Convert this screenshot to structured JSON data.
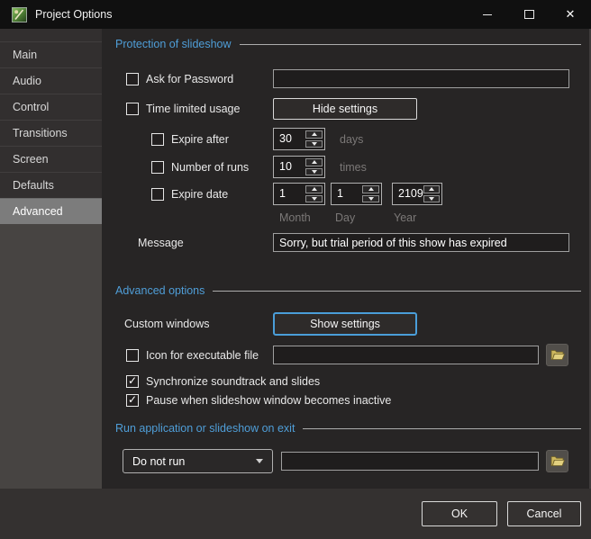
{
  "window": {
    "title": "Project Options"
  },
  "sidebar": {
    "items": [
      {
        "label": "Main",
        "selected": false
      },
      {
        "label": "Audio",
        "selected": false
      },
      {
        "label": "Control",
        "selected": false
      },
      {
        "label": "Transitions",
        "selected": false
      },
      {
        "label": "Screen",
        "selected": false
      },
      {
        "label": "Defaults",
        "selected": false
      },
      {
        "label": "Advanced",
        "selected": true
      }
    ]
  },
  "sections": {
    "protection": {
      "title": "Protection of slideshow",
      "ask_for_password": {
        "label": "Ask for Password",
        "checked": false,
        "value": ""
      },
      "time_limited": {
        "label": "Time limited usage",
        "checked": false,
        "button": "Hide settings"
      },
      "expire_after": {
        "label": "Expire after",
        "checked": false,
        "value": "30",
        "unit": "days"
      },
      "number_of_runs": {
        "label": "Number of runs",
        "checked": false,
        "value": "10",
        "unit": "times"
      },
      "expire_date": {
        "label": "Expire date",
        "checked": false,
        "month": "1",
        "day": "1",
        "year": "2109",
        "month_label": "Month",
        "day_label": "Day",
        "year_label": "Year"
      },
      "message": {
        "label": "Message",
        "value": "Sorry, but trial period of this show has expired"
      }
    },
    "advanced": {
      "title": "Advanced options",
      "custom_windows": {
        "label": "Custom windows",
        "button": "Show settings"
      },
      "icon_for_exe": {
        "label": "Icon for executable file",
        "checked": false,
        "value": ""
      },
      "synchronize": {
        "label": "Synchronize soundtrack and slides",
        "checked": true
      },
      "pause_inactive": {
        "label": "Pause when slideshow window becomes inactive",
        "checked": true
      }
    },
    "run_on_exit": {
      "title": "Run application or slideshow on exit",
      "dropdown_value": "Do not run",
      "path_value": ""
    }
  },
  "footer": {
    "ok": "OK",
    "cancel": "Cancel"
  },
  "colors": {
    "accent_blue": "#4f9ed8",
    "folder_yellow": "#dbc66f",
    "selected_nav_gray": "#7c7c7c",
    "titlebar_black": "#101010",
    "content_bg": "#272525"
  }
}
